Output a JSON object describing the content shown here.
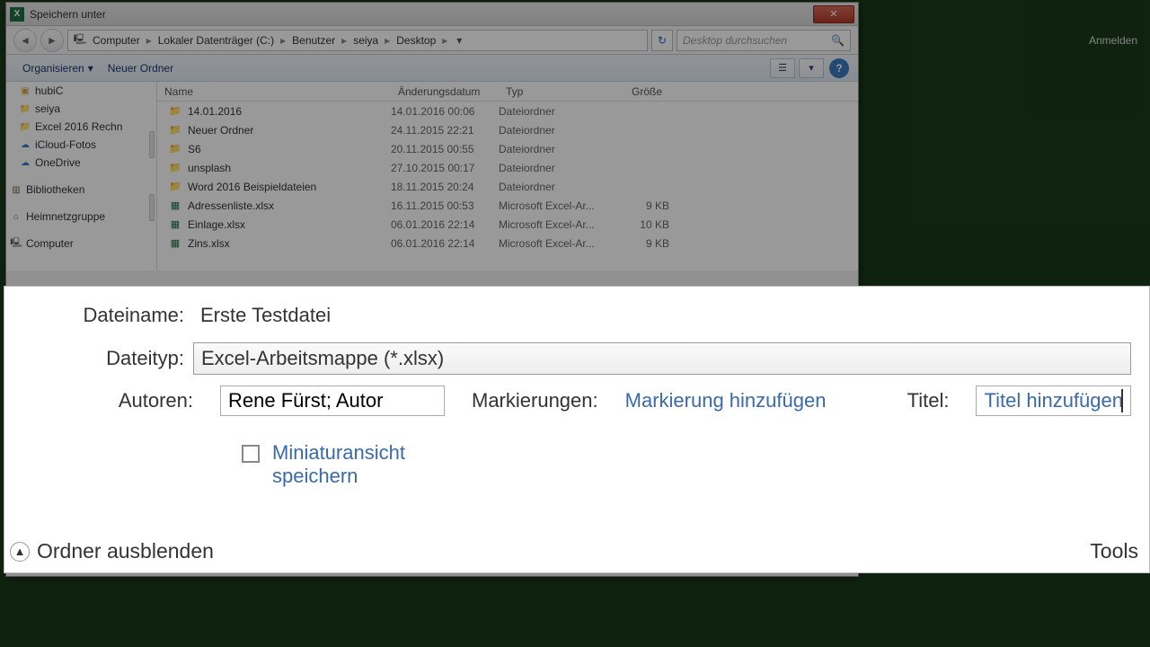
{
  "app": {
    "signin": "Anmelden"
  },
  "dialog": {
    "title": "Speichern unter",
    "breadcrumb": [
      "Computer",
      "Lokaler Datenträger (C:)",
      "Benutzer",
      "seiya",
      "Desktop"
    ],
    "search_placeholder": "Desktop durchsuchen",
    "toolbar": {
      "organize": "Organisieren",
      "new_folder": "Neuer Ordner"
    },
    "sidebar": {
      "items": [
        {
          "label": "hubiC"
        },
        {
          "label": "seiya"
        },
        {
          "label": "Excel 2016 Rechn"
        },
        {
          "label": "iCloud-Fotos"
        },
        {
          "label": "OneDrive"
        }
      ],
      "libraries": "Bibliotheken",
      "homegroup": "Heimnetzgruppe",
      "computer": "Computer"
    },
    "columns": {
      "name": "Name",
      "date": "Änderungsdatum",
      "type": "Typ",
      "size": "Größe"
    },
    "files": [
      {
        "name": "14.01.2016",
        "date": "14.01.2016 00:06",
        "type": "Dateiordner",
        "size": "",
        "kind": "folder"
      },
      {
        "name": "Neuer Ordner",
        "date": "24.11.2015 22:21",
        "type": "Dateiordner",
        "size": "",
        "kind": "folder"
      },
      {
        "name": "S6",
        "date": "20.11.2015 00:55",
        "type": "Dateiordner",
        "size": "",
        "kind": "folder"
      },
      {
        "name": "unsplash",
        "date": "27.10.2015 00:17",
        "type": "Dateiordner",
        "size": "",
        "kind": "folder"
      },
      {
        "name": "Word 2016 Beispieldateien",
        "date": "18.11.2015 20:24",
        "type": "Dateiordner",
        "size": "",
        "kind": "folder"
      },
      {
        "name": "Adressenliste.xlsx",
        "date": "16.11.2015 00:53",
        "type": "Microsoft Excel-Ar...",
        "size": "9 KB",
        "kind": "excel"
      },
      {
        "name": "Einlage.xlsx",
        "date": "06.01.2016 22:14",
        "type": "Microsoft Excel-Ar...",
        "size": "10 KB",
        "kind": "excel"
      },
      {
        "name": "Zins.xlsx",
        "date": "06.01.2016 22:14",
        "type": "Microsoft Excel-Ar...",
        "size": "9 KB",
        "kind": "excel"
      }
    ]
  },
  "panel": {
    "filename_label": "Dateiname:",
    "filename_value": "Erste Testdatei",
    "filetype_label": "Dateityp:",
    "filetype_value": "Excel-Arbeitsmappe (*.xlsx)",
    "authors_label": "Autoren:",
    "authors_value": "Rene Fürst; Autor",
    "tags_label": "Markierungen:",
    "tags_placeholder": "Markierung hinzufügen",
    "title_label": "Titel:",
    "title_placeholder": "Titel hinzufügen",
    "thumbnail_label": "Miniaturansicht speichern",
    "hide_folders": "Ordner ausblenden",
    "tools": "Tools"
  }
}
